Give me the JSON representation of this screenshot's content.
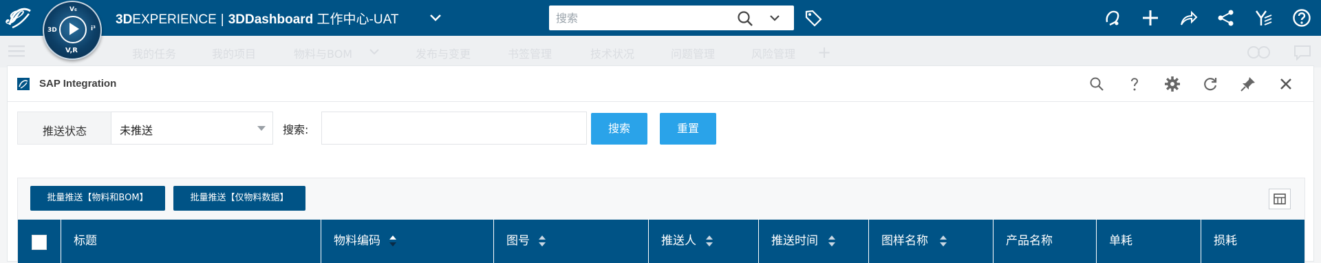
{
  "topbar": {
    "brand_3d": "3D",
    "brand_experience": "EXPERIENCE",
    "brand_separator": "|",
    "brand_app_3d": "3D",
    "brand_app_dashboard": "Dashboard",
    "brand_suffix": "工作中心-UAT",
    "compass": {
      "top": "V₆",
      "left": "3D",
      "right": "i³",
      "bottom": "V,R"
    },
    "search_placeholder": "搜索",
    "icons": [
      "notification-icon",
      "add-icon",
      "share-icon",
      "network-icon",
      "apps-icon",
      "help-icon"
    ]
  },
  "tabs": [
    {
      "label": "我的任务"
    },
    {
      "label": "我的项目"
    },
    {
      "label": "物料与BOM"
    },
    {
      "label": "发布与变更"
    },
    {
      "label": "书签管理"
    },
    {
      "label": "技术状况"
    },
    {
      "label": "问题管理"
    },
    {
      "label": "风险管理"
    }
  ],
  "widget": {
    "title": "SAP Integration",
    "filter": {
      "status_label": "推送状态",
      "status_value": "未推送",
      "keyword_label": "搜索:",
      "keyword_value": "",
      "search_button": "搜索",
      "reset_button": "重置"
    },
    "actions": {
      "push_material_bom": "批量推送【物料和BOM】",
      "push_material_only": "批量推送【仅物料数据】"
    },
    "columns": [
      {
        "label": "标题",
        "sortable": false
      },
      {
        "label": "物料编码",
        "sortable": true,
        "sort": "desc"
      },
      {
        "label": "图号",
        "sortable": true
      },
      {
        "label": "推送人",
        "sortable": true
      },
      {
        "label": "推送时间",
        "sortable": true
      },
      {
        "label": "图样名称",
        "sortable": true
      },
      {
        "label": "产品名称",
        "sortable": false
      },
      {
        "label": "单耗",
        "sortable": false
      },
      {
        "label": "损耗",
        "sortable": false
      }
    ]
  },
  "colors": {
    "topbar": "#005386",
    "accent_button": "#2aa3e9",
    "dark_button": "#005386",
    "table_header": "#005386"
  }
}
